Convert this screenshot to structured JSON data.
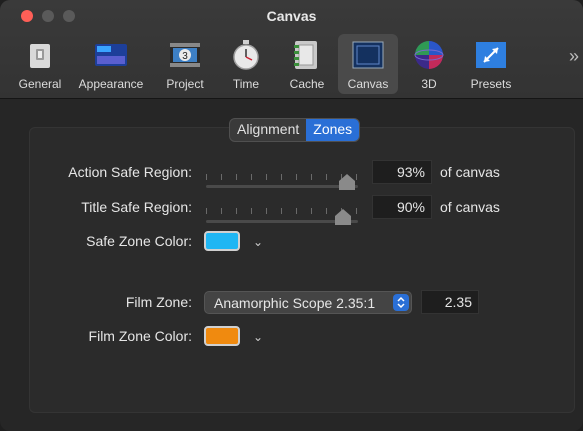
{
  "window": {
    "title": "Canvas"
  },
  "toolbar": {
    "items": [
      {
        "label": "General",
        "icon": "general-icon"
      },
      {
        "label": "Appearance",
        "icon": "appearance-icon"
      },
      {
        "label": "Project",
        "icon": "project-icon"
      },
      {
        "label": "Time",
        "icon": "time-icon"
      },
      {
        "label": "Cache",
        "icon": "cache-icon"
      },
      {
        "label": "Canvas",
        "icon": "canvas-icon",
        "selected": true
      },
      {
        "label": "3D",
        "icon": "3d-icon"
      },
      {
        "label": "Presets",
        "icon": "presets-icon"
      }
    ],
    "more": "»"
  },
  "tabs": {
    "alignment": "Alignment",
    "zones": "Zones",
    "active": "Zones"
  },
  "action_safe": {
    "label": "Action Safe Region:",
    "value": "93%",
    "suffix": "of canvas",
    "fraction": 0.93
  },
  "title_safe": {
    "label": "Title Safe Region:",
    "value": "90%",
    "suffix": "of canvas",
    "fraction": 0.9
  },
  "safe_zone_color": {
    "label": "Safe Zone Color:",
    "color": "#1fb6f3"
  },
  "film_zone": {
    "label": "Film Zone:",
    "selected": "Anamorphic Scope 2.35:1",
    "value": "2.35"
  },
  "film_zone_color": {
    "label": "Film Zone Color:",
    "color": "#f08a0f"
  },
  "colors": {
    "accent": "#2a6fd6",
    "close": "#ff5f57"
  }
}
